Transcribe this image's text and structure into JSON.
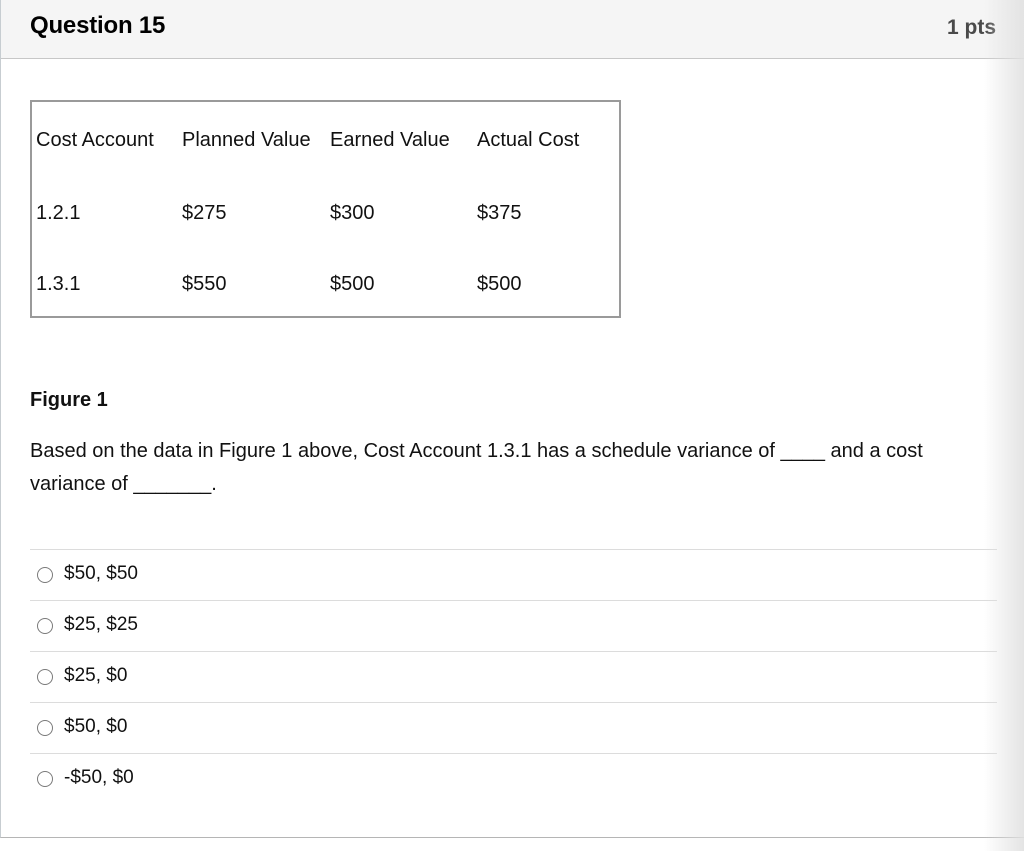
{
  "question": {
    "title": "Question 15",
    "points": "1 pts"
  },
  "table": {
    "headers": [
      "Cost Account",
      "Planned Value",
      "Earned Value",
      "Actual Cost"
    ],
    "rows": [
      [
        "1.2.1",
        "$275",
        "$300",
        "$375"
      ],
      [
        "1.3.1",
        "$550",
        "$500",
        "$500"
      ]
    ]
  },
  "figure_label": "Figure 1",
  "question_text": "Based on the data in Figure 1 above, Cost Account 1.3.1 has a schedule variance of ____ and a cost variance of _______.",
  "answers": [
    {
      "label": "$50, $50",
      "selected": false
    },
    {
      "label": "$25, $25",
      "selected": false
    },
    {
      "label": "$25, $0",
      "selected": false
    },
    {
      "label": "$50, $0",
      "selected": false
    },
    {
      "label": "-$50, $0",
      "selected": false
    }
  ],
  "colors": {
    "header_bg": "#f5f5f5",
    "border": "#c7c7c7",
    "text": "#111111"
  }
}
